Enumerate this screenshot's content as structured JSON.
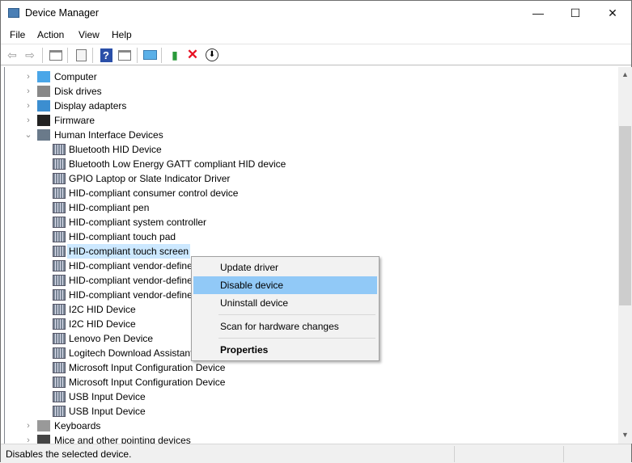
{
  "window": {
    "title": "Device Manager",
    "minimize": "—",
    "maximize": "☐",
    "close": "✕"
  },
  "menu": [
    "File",
    "Action",
    "View",
    "Help"
  ],
  "toolbar": [
    "back-icon",
    "forward-icon",
    "show-hide-console-tree-icon",
    "properties-icon",
    "help-icon",
    "action-pane-icon",
    "scan-hardware-icon",
    "update-driver-icon",
    "uninstall-icon",
    "disable-icon"
  ],
  "tree": {
    "categories_top": [
      {
        "label": "Computer",
        "expanded": false
      },
      {
        "label": "Disk drives",
        "expanded": false
      },
      {
        "label": "Display adapters",
        "expanded": false
      },
      {
        "label": "Firmware",
        "expanded": false
      },
      {
        "label": "Human Interface Devices",
        "expanded": true
      }
    ],
    "hid_devices": [
      "Bluetooth HID Device",
      "Bluetooth Low Energy GATT compliant HID device",
      "GPIO Laptop or Slate Indicator Driver",
      "HID-compliant consumer control device",
      "HID-compliant pen",
      "HID-compliant system controller",
      "HID-compliant touch pad",
      "HID-compliant touch screen",
      "HID-compliant vendor-defined device",
      "HID-compliant vendor-defined device",
      "HID-compliant vendor-defined device",
      "I2C HID Device",
      "I2C HID Device",
      "Lenovo Pen Device",
      "Logitech Download Assistant",
      "Microsoft Input Configuration Device",
      "Microsoft Input Configuration Device",
      "USB Input Device",
      "USB Input Device"
    ],
    "selected": "HID-compliant touch screen",
    "categories_bottom": [
      {
        "label": "Keyboards",
        "expanded": false
      },
      {
        "label": "Mice and other pointing devices",
        "expanded": false
      }
    ]
  },
  "context_menu": {
    "items": [
      "Update driver",
      "Disable device",
      "Uninstall device",
      "Scan for hardware changes",
      "Properties"
    ],
    "highlighted": "Disable device"
  },
  "status": {
    "text": "Disables the selected device."
  },
  "colors": {
    "selection": "#cce8ff",
    "menu_highlight": "#91c9f7",
    "uninstall": "#e81123"
  }
}
